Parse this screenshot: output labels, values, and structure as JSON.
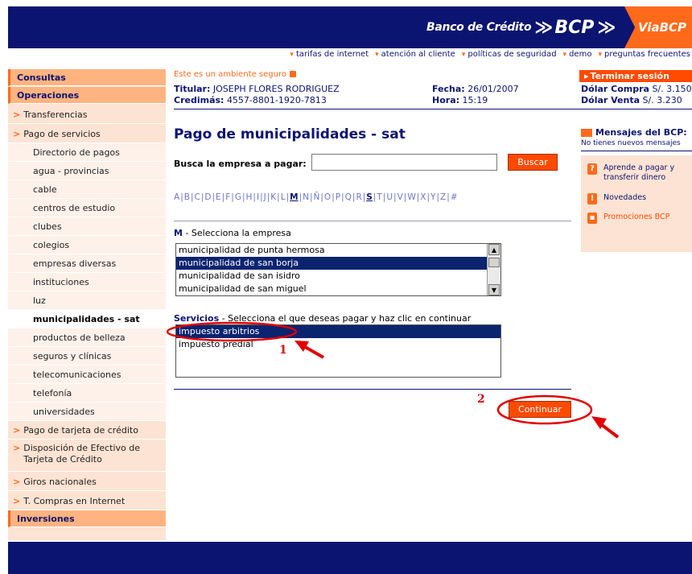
{
  "header": {
    "bank_name": "Banco de Crédito",
    "brand": "BCP",
    "product": "ViaBCP",
    "links": [
      "tarifas de internet",
      "atención al cliente",
      "políticas de seguridad",
      "demo",
      "preguntas frecuentes"
    ]
  },
  "sidebar": {
    "items": [
      {
        "label": "Consultas",
        "type": "main"
      },
      {
        "label": "Operaciones",
        "type": "main"
      },
      {
        "label": "Transferencias",
        "type": "section"
      },
      {
        "label": "Pago de servicios",
        "type": "section"
      },
      {
        "label": "Directorio de pagos",
        "type": "sub"
      },
      {
        "label": "agua - provincias",
        "type": "sub"
      },
      {
        "label": "cable",
        "type": "sub"
      },
      {
        "label": "centros de estudio",
        "type": "sub"
      },
      {
        "label": "clubes",
        "type": "sub"
      },
      {
        "label": "colegios",
        "type": "sub"
      },
      {
        "label": "empresas diversas",
        "type": "sub"
      },
      {
        "label": "instituciones",
        "type": "sub"
      },
      {
        "label": "luz",
        "type": "sub"
      },
      {
        "label": "municipalidades - sat",
        "type": "sub-active"
      },
      {
        "label": "productos de belleza",
        "type": "sub"
      },
      {
        "label": "seguros y clínicas",
        "type": "sub"
      },
      {
        "label": "telecomunicaciones",
        "type": "sub"
      },
      {
        "label": "telefonía",
        "type": "sub"
      },
      {
        "label": "universidades",
        "type": "sub"
      },
      {
        "label": "Pago de tarjeta de crédito",
        "type": "section"
      },
      {
        "label": "Disposición de Efectivo de Tarjeta de Crédito",
        "type": "section"
      },
      {
        "label": "Giros nacionales",
        "type": "section"
      },
      {
        "label": "T. Compras en Internet",
        "type": "section"
      },
      {
        "label": "Inversiones",
        "type": "main"
      }
    ]
  },
  "session": {
    "safe_text": "Este es un ambiente seguro",
    "logout": "Terminar sesión",
    "titular_label": "Titular:",
    "titular": "JOSEPH FLORES RODRIGUEZ",
    "credimas_label": "Credimás:",
    "credimas": "4557-8801-1920-7813",
    "fecha_label": "Fecha:",
    "fecha": "26/01/2007",
    "hora_label": "Hora:",
    "hora": "15:19",
    "compra_label": "Dólar Compra",
    "compra": "S/. 3.150",
    "venta_label": "Dólar Venta",
    "venta": "S/. 3.230"
  },
  "page": {
    "title": "Pago de municipalidades - sat",
    "search_label": "Busca la empresa a pagar:",
    "search_value": "",
    "search_button": "Buscar",
    "alphabet": [
      "A",
      "B",
      "C",
      "D",
      "E",
      "F",
      "G",
      "H",
      "I",
      "J",
      "K",
      "L",
      "M",
      "N",
      "Ñ",
      "O",
      "P",
      "Q",
      "R",
      "S",
      "T",
      "U",
      "V",
      "W",
      "X",
      "Y",
      "Z",
      "#"
    ],
    "selected_letter": "M",
    "empresa_letter": "M",
    "empresa_hint": "- Selecciona la empresa",
    "empresas": [
      "municipalidad de punta hermosa",
      "municipalidad de san borja",
      "municipalidad de san isidro",
      "municipalidad de san miguel"
    ],
    "empresa_selected": 1,
    "servicios_label": "Servicios",
    "servicios_hint": "- Selecciona el que deseas pagar y haz clic en continuar",
    "servicios": [
      "impuesto arbitrios",
      "impuesto predial"
    ],
    "servicio_selected": 0,
    "continue_button": "Continuar"
  },
  "messages": {
    "title": "Mensajes del BCP:",
    "subtitle": "No tienes nuevos mensajes",
    "items": [
      {
        "label": "Aprende a pagar y transferir dinero",
        "icon": "question-icon"
      },
      {
        "label": "Novedades",
        "icon": "exclamation-icon"
      },
      {
        "label": "Promociones BCP",
        "icon": "gift-icon"
      }
    ]
  },
  "annotations": {
    "step1": "1",
    "step2": "2"
  },
  "colors": {
    "navy": "#0b1470",
    "orange": "#ff4a00",
    "red_annotation": "#e00000"
  }
}
